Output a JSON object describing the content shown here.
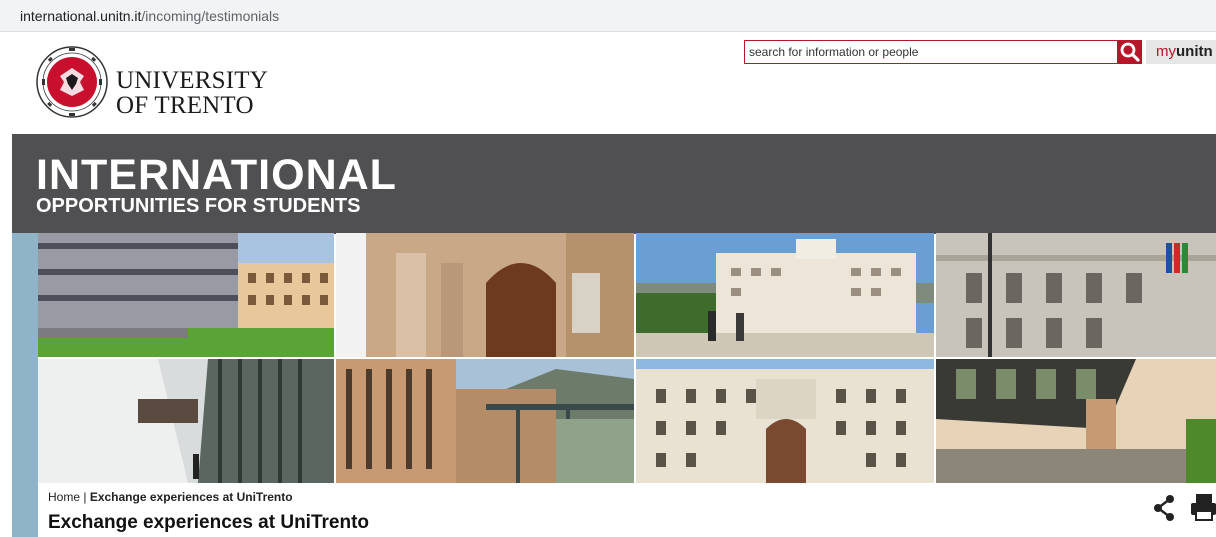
{
  "browser": {
    "url_host": "international.unitn.it",
    "url_path": "/incoming/testimonials"
  },
  "header": {
    "university_line1": "UNIVERSITY",
    "university_line2": "OF TRENTO",
    "search_placeholder": "search for information or people",
    "myunitn_prefix": "my",
    "myunitn_suffix": "unitn"
  },
  "banner": {
    "title": "INTERNATIONAL",
    "subtitle": "OPPORTUNITIES FOR STUDENTS"
  },
  "breadcrumb": {
    "home": "Home",
    "separator": "|",
    "current": "Exchange experiences at UniTrento"
  },
  "page": {
    "title": "Exchange experiences at UniTrento"
  },
  "icons": [
    "search-icon",
    "share-icon",
    "print-icon",
    "university-seal-icon"
  ],
  "colors": {
    "brand_red": "#b8152a",
    "banner_grey": "#505052"
  }
}
